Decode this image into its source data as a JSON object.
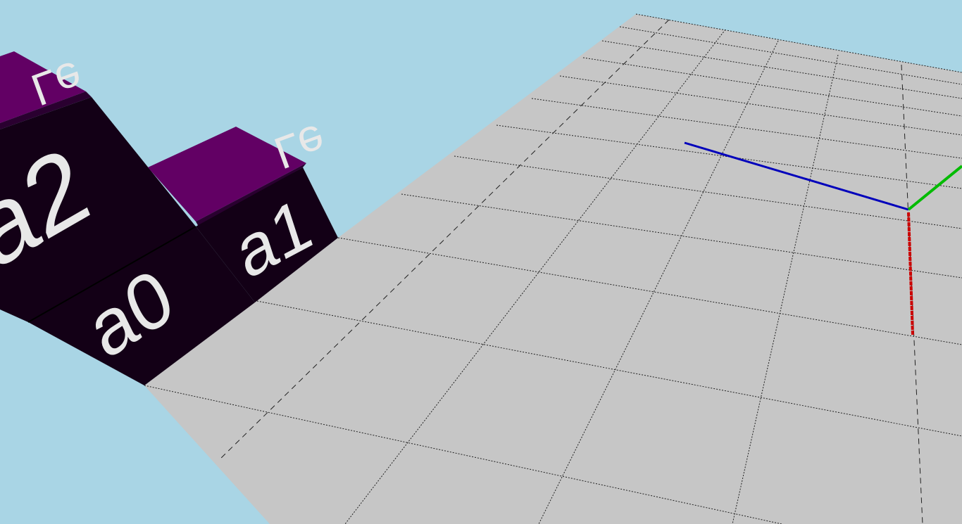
{
  "scene": {
    "background_color": "#a9d5e5",
    "floor_color": "#c6c6c6",
    "cube_side_color": "#130016",
    "cube_top_color": "#620064",
    "label_color": "#e8e8e8"
  },
  "cubes": {
    "a0": {
      "label": "a0"
    },
    "a1": {
      "label": "a1"
    },
    "a2": {
      "label": "a2"
    },
    "top_small": {
      "label": "Le"
    },
    "top_large": {
      "label": "Le"
    }
  },
  "axes": {
    "x_color": "#0000bb",
    "y_color": "#00bb00",
    "z_color": "#cc0000"
  }
}
